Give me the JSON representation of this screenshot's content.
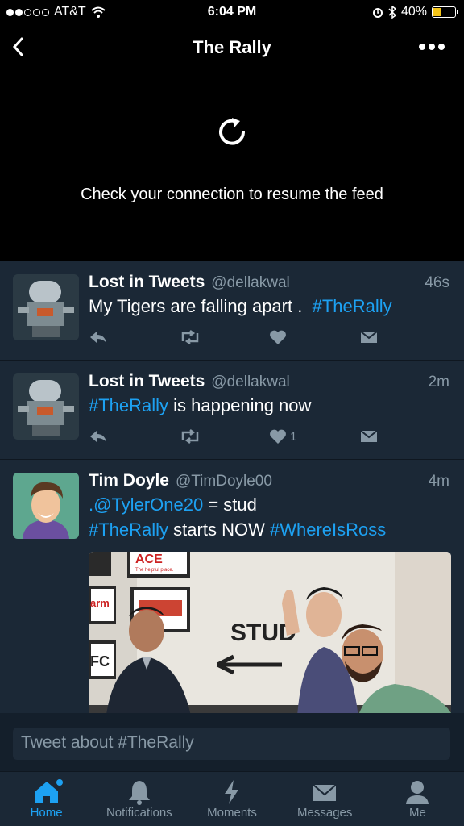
{
  "status": {
    "carrier": "AT&T",
    "time": "6:04 PM",
    "battery": "40%",
    "battery_level": 0.4,
    "signal_bars_filled": 2,
    "signal_bars_total": 5
  },
  "nav": {
    "title": "The Rally"
  },
  "offline": {
    "message": "Check your connection to resume the feed"
  },
  "tweets": [
    {
      "name": "Lost in Tweets",
      "handle": "@dellakwal",
      "time": "46s",
      "text_plain": "My Tigers are falling apart .",
      "hashtag": "#TheRally",
      "like_count": ""
    },
    {
      "name": "Lost in Tweets",
      "handle": "@dellakwal",
      "time": "2m",
      "hashtag": "#TheRally",
      "text_plain": "is happening now",
      "like_count": "1"
    },
    {
      "name": "Tim Doyle",
      "handle": "@TimDoyle00",
      "time": "4m",
      "mention": ".@TylerOne20",
      "line1_rest": "= stud",
      "hashtag1": "#TheRally",
      "line2_mid": "starts NOW",
      "hashtag2": "#WhereIsRoss"
    }
  ],
  "media_text": {
    "ace": "ACE",
    "tagline": "The helpful place.",
    "side1": "arm",
    "side2": "FC",
    "wall": "STUD"
  },
  "compose": {
    "placeholder": "Tweet about #TheRally"
  },
  "tabs": [
    {
      "label": "Home",
      "icon": "home-icon"
    },
    {
      "label": "Notifications",
      "icon": "bell-icon"
    },
    {
      "label": "Moments",
      "icon": "lightning-icon"
    },
    {
      "label": "Messages",
      "icon": "envelope-icon"
    },
    {
      "label": "Me",
      "icon": "person-icon"
    }
  ],
  "colors": {
    "accent": "#1da1f2",
    "feed_bg": "#1b2836",
    "secondary": "#8899a6"
  }
}
